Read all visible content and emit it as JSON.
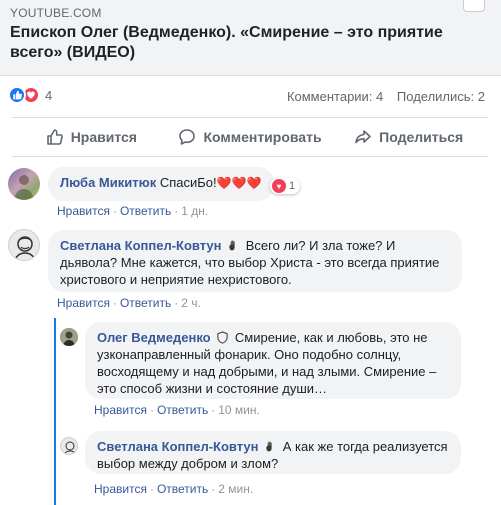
{
  "link": {
    "domain": "YOUTUBE.COM",
    "title": "Епископ Олег (Ведмеденко). «Смирение – это приятие всего» (ВИДЕО)"
  },
  "stats": {
    "reaction_count": "4",
    "comments": "Комментарии: 4",
    "shares": "Поделились: 2"
  },
  "actions": {
    "like": "Нравится",
    "comment": "Комментировать",
    "share": "Поделиться"
  },
  "comments": [
    {
      "author": "Люба Микитюк",
      "text": "СпасиБо!",
      "hearts": "❤️❤️❤️",
      "reaction_count": "1",
      "like": "Нравится",
      "reply": "Ответить",
      "time": "1 дн."
    },
    {
      "author": "Светлана Коппел-Ковтун",
      "text": "Всего ли? И зла тоже? И дьявола? Мне кажется, что выбор Христа - это всегда приятие христового и неприятие нехристового.",
      "like": "Нравится",
      "reply": "Ответить",
      "time": "2 ч."
    },
    {
      "author": "Олег Ведмеденко",
      "text": "Смирение, как и любовь, это не узконаправленный фонарик. Оно подобно солнцу, восходящему и над добрыми, и над злыми. Смирение – это способ жизни и состояние души…",
      "like": "Нравится",
      "reply": "Ответить",
      "time": "10 мин."
    },
    {
      "author": "Светлана Коппел-Ковтун",
      "text": "А как же тогда реализуется выбор между добром и злом?",
      "like": "Нравится",
      "reply": "Ответить",
      "time": "2 мин."
    }
  ],
  "icons": {
    "reactions": [
      "like-icon",
      "love-icon"
    ],
    "actions": [
      "thumbs-up-icon",
      "comment-bubble-icon",
      "share-arrow-icon"
    ],
    "badges": [
      "wave-hand-icon",
      "shield-badge-icon"
    ]
  },
  "colors": {
    "link_name": "#385898",
    "like_blue": "#1877f2",
    "love_red": "#f33e58",
    "bubble_bg": "#f2f3f5"
  }
}
